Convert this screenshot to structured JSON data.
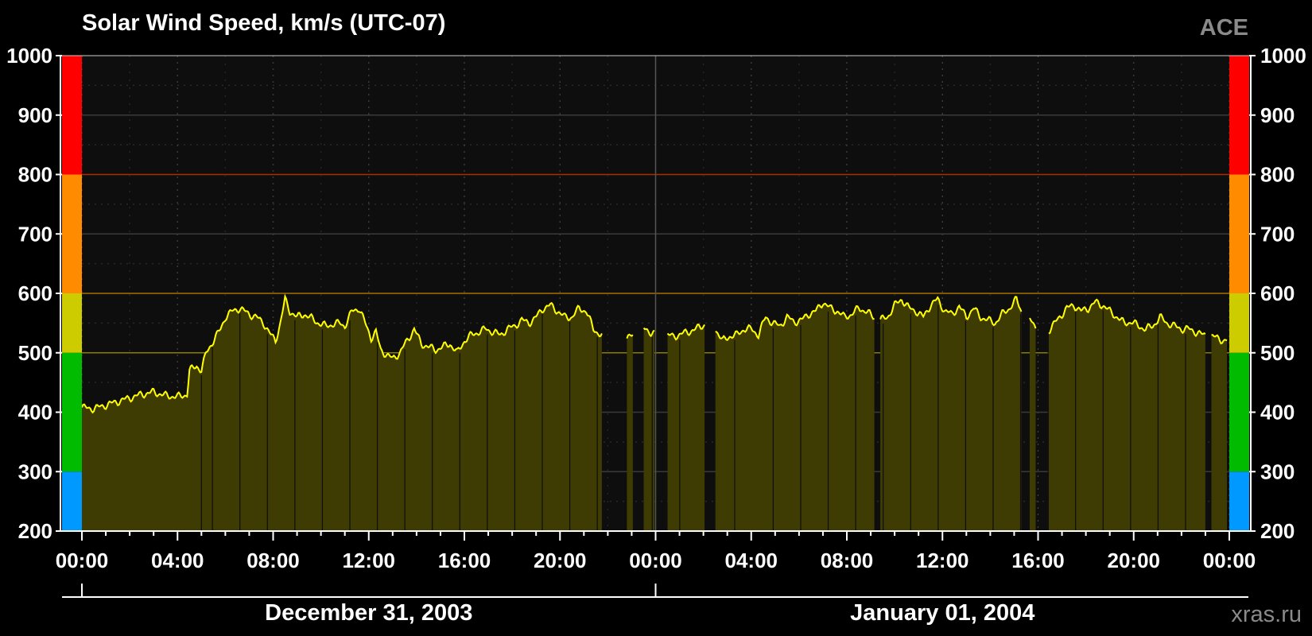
{
  "chart_data": {
    "type": "area",
    "title": "Solar Wind Speed, km/s (UTC-07)",
    "source": "ACE",
    "credit": "xras.ru",
    "xlabel": "",
    "ylabel": "",
    "ylim": [
      200,
      1000
    ],
    "y_ticks": [
      "1000",
      "900",
      "800",
      "700",
      "600",
      "500",
      "400",
      "300",
      "200"
    ],
    "x_range_hours": [
      0,
      48
    ],
    "x_tick_labels": [
      "00:00",
      "04:00",
      "08:00",
      "12:00",
      "16:00",
      "20:00",
      "00:00",
      "04:00",
      "08:00",
      "12:00",
      "16:00",
      "20:00",
      "00:00"
    ],
    "dates": [
      "December 31, 2003",
      "January 01, 2004"
    ],
    "grid": true,
    "colors": {
      "line": "#ffff00",
      "fill": "#3e3b03",
      "plot_bg": "#0e0e0e",
      "threshold_500": "#8a7d00",
      "threshold_600": "#a57000",
      "threshold_800": "#b02a00",
      "grid": "#3a3a3a"
    },
    "bands": [
      {
        "from": 200,
        "to": 300,
        "color": "#0099ff"
      },
      {
        "from": 300,
        "to": 500,
        "color": "#00bb00"
      },
      {
        "from": 500,
        "to": 600,
        "color": "#cccc00"
      },
      {
        "from": 600,
        "to": 800,
        "color": "#ff8c00"
      },
      {
        "from": 800,
        "to": 1000,
        "color": "#ff0000"
      }
    ],
    "series": [
      {
        "x": [
          0.0,
          0.5,
          1.0,
          1.5,
          2.0,
          2.5,
          3.0,
          3.5,
          4.0,
          4.4,
          4.5,
          4.8,
          5.0,
          5.2,
          5.5,
          5.8,
          6.0,
          6.3,
          6.6,
          7.0,
          7.3,
          7.6,
          7.9,
          8.1,
          8.3,
          8.5,
          8.7,
          9.0,
          9.3,
          9.6,
          9.9,
          10.2,
          10.5,
          10.8,
          11.0,
          11.3,
          11.6,
          11.9,
          12.1,
          12.3,
          12.5,
          12.8,
          13.0,
          13.3,
          13.6,
          13.9,
          14.2,
          14.5,
          14.8,
          15.1,
          15.4,
          15.7,
          16.0,
          16.3,
          16.6,
          16.9,
          17.2,
          17.5,
          17.8,
          18.1,
          18.4,
          18.7,
          19.0,
          19.3,
          19.6,
          19.9,
          20.2,
          20.5,
          20.8,
          21.1,
          21.4,
          21.7,
          22.0,
          22.3,
          22.6,
          22.9,
          23.2,
          23.5,
          23.8,
          24.1,
          24.4,
          24.7,
          25.0,
          25.3,
          25.6,
          25.9,
          26.2,
          26.5,
          26.8,
          27.1,
          27.4,
          27.7,
          28.0,
          28.3,
          28.6,
          28.9,
          29.2,
          29.5,
          29.8,
          30.1,
          30.4,
          30.7,
          31.0,
          31.3,
          31.6,
          31.9,
          32.2,
          32.5,
          32.8,
          33.1,
          33.4,
          33.7,
          34.0,
          34.3,
          34.6,
          34.9,
          35.2,
          35.5,
          35.8,
          36.1,
          36.4,
          36.7,
          37.0,
          37.3,
          37.6,
          37.9,
          38.2,
          38.5,
          38.8,
          39.1,
          39.4,
          39.7,
          40.0,
          40.3,
          40.6,
          40.9,
          41.2,
          41.5,
          41.8,
          42.1,
          42.4,
          42.7,
          43.0,
          43.3,
          43.6,
          43.9,
          44.2,
          44.5,
          44.8,
          45.1,
          45.4,
          45.7,
          46.0,
          46.3,
          46.6,
          46.9,
          47.2,
          47.5,
          47.8
        ],
        "y": [
          408,
          406,
          412,
          418,
          424,
          430,
          434,
          428,
          426,
          430,
          470,
          478,
          470,
          500,
          520,
          540,
          560,
          570,
          575,
          565,
          560,
          550,
          530,
          520,
          550,
          590,
          570,
          560,
          565,
          558,
          550,
          545,
          548,
          550,
          545,
          570,
          575,
          545,
          525,
          535,
          505,
          495,
          490,
          500,
          520,
          540,
          515,
          510,
          505,
          510,
          515,
          500,
          520,
          530,
          535,
          540,
          535,
          530,
          540,
          545,
          555,
          550,
          560,
          575,
          580,
          570,
          560,
          560,
          575,
          570,
          540,
          530,
          525,
          520,
          522,
          525,
          535,
          540,
          535,
          532,
          530,
          528,
          530,
          535,
          538,
          545,
          550,
          540,
          520,
          528,
          530,
          540,
          540,
          530,
          560,
          550,
          545,
          560,
          552,
          555,
          565,
          570,
          585,
          575,
          570,
          560,
          565,
          575,
          570,
          560,
          555,
          560,
          580,
          590,
          575,
          570,
          560,
          580,
          590,
          570,
          565,
          578,
          560,
          575,
          560,
          555,
          550,
          565,
          575,
          590,
          560,
          555,
          540,
          530,
          545,
          560,
          575,
          580,
          570,
          575,
          585,
          580,
          570,
          560,
          550,
          552,
          545,
          540,
          545,
          560,
          550,
          545,
          540,
          540,
          535,
          530,
          528,
          525,
          520
        ],
        "gaps": [
          [
            21.8,
            22.8
          ],
          [
            23.1,
            23.5
          ],
          [
            24.0,
            24.5
          ],
          [
            26.1,
            26.5
          ],
          [
            33.2,
            33.4
          ],
          [
            39.3,
            39.6
          ],
          [
            39.9,
            40.4
          ],
          [
            47.0,
            47.2
          ],
          [
            47.9,
            48.0
          ]
        ]
      }
    ]
  }
}
